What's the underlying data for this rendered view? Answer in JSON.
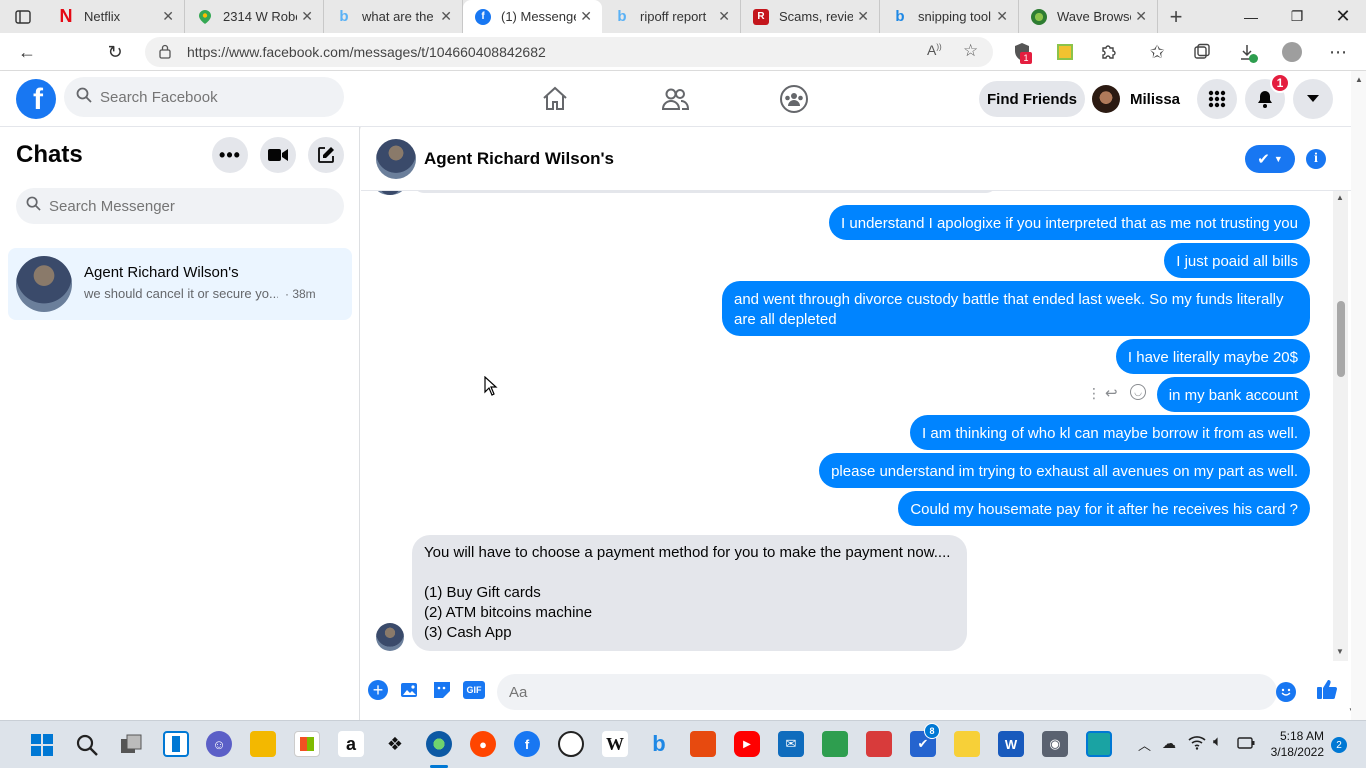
{
  "browser": {
    "tabs": [
      {
        "title": "Netflix",
        "icon": "netflix-icon",
        "color": "#e50914"
      },
      {
        "title": "2314 W Robe",
        "icon": "maps-icon",
        "color": "#34a853"
      },
      {
        "title": "what are the",
        "icon": "bing-icon",
        "color": "#5ab1f5"
      },
      {
        "title": "(1) Messenge",
        "icon": "facebook-icon",
        "color": "#1877f2"
      },
      {
        "title": "ripoff report",
        "icon": "bing-icon",
        "color": "#5ab1f5"
      },
      {
        "title": "Scams, review",
        "icon": "ripoff-report-icon",
        "color": "#c4161c"
      },
      {
        "title": "snipping tool",
        "icon": "bing-icon",
        "color": "#1e88e5"
      },
      {
        "title": "Wave Browse",
        "icon": "wave-icon",
        "color": "#2e7d32"
      }
    ],
    "url": "https://www.facebook.com/messages/t/104660408842682",
    "extension_badge": "1"
  },
  "fb": {
    "logo": "f",
    "search_placeholder": "Search Facebook",
    "find_friends": "Find Friends",
    "profile_name": "Milissa",
    "notification_count": "1"
  },
  "chats": {
    "title": "Chats",
    "search_placeholder": "Search Messenger",
    "items": [
      {
        "name": "Agent Richard Wilson's",
        "preview": "we should cancel it or secure yo...",
        "time": "· 38m"
      }
    ]
  },
  "conversation": {
    "contact_name": "Agent Richard Wilson's",
    "messages": [
      {
        "from": "me",
        "text": "I understand I apologixe if you interpreted that as me not trusting you"
      },
      {
        "from": "me",
        "text": "I just poaid all bills"
      },
      {
        "from": "me",
        "text": "and went through divorce custody battle that ended last week. So my funds literally are all depleted"
      },
      {
        "from": "me",
        "text": "I have literally maybe 20$"
      },
      {
        "from": "me",
        "text": "in my bank account"
      },
      {
        "from": "me",
        "text": "I am thinking of who kl can maybe borrow it from as well."
      },
      {
        "from": "me",
        "text": "please understand im trying to exhaust all avenues on my part as well."
      },
      {
        "from": "me",
        "text": "Could my housemate pay for it after he receives his card ?"
      },
      {
        "from": "them",
        "lines": [
          "You will have to choose a payment method for you to make the payment now....",
          "",
          "(1) Buy Gift cards",
          "(2) ATM bitcoins machine",
          "(3) Cash App"
        ]
      }
    ],
    "composer_placeholder": "Aa"
  },
  "taskbar": {
    "time": "5:18 AM",
    "date": "3/18/2022",
    "notification_count": "2",
    "todo_badge": "8"
  },
  "colors": {
    "messenger_blue": "#0084ff",
    "facebook_blue": "#1877f2",
    "bubble_gray": "#e4e6eb",
    "badge_red": "#e41e3f"
  }
}
